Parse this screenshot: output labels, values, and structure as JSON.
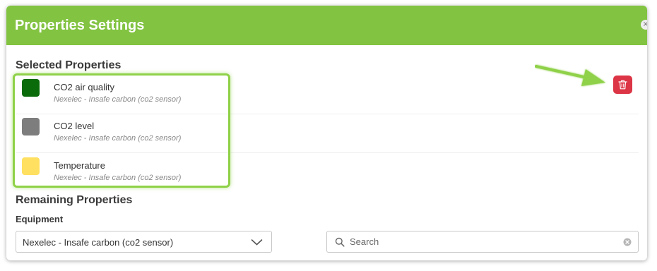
{
  "header": {
    "title": "Properties Settings",
    "close_glyph": "×",
    "background_color": "#82c341"
  },
  "selected_section": {
    "title": "Selected Properties",
    "items": [
      {
        "name": "CO2 air quality",
        "equipment": "Nexelec - Insafe carbon (co2 sensor)",
        "color": "#0a6b0a"
      },
      {
        "name": "CO2 level",
        "equipment": "Nexelec - Insafe carbon (co2 sensor)",
        "color": "#7d7d7d"
      },
      {
        "name": "Temperature",
        "equipment": "Nexelec - Insafe carbon (co2 sensor)",
        "color": "#ffe060"
      }
    ],
    "delete_icon": "trash-icon",
    "delete_color": "#dc3545"
  },
  "remaining_section": {
    "title": "Remaining Properties",
    "equipment_label": "Equipment",
    "equipment_selected": "Nexelec - Insafe carbon (co2 sensor)",
    "search_placeholder": "Search",
    "search_value": ""
  },
  "annotation": {
    "highlight_color": "#8fd148",
    "arrow_color": "#8fd148"
  }
}
